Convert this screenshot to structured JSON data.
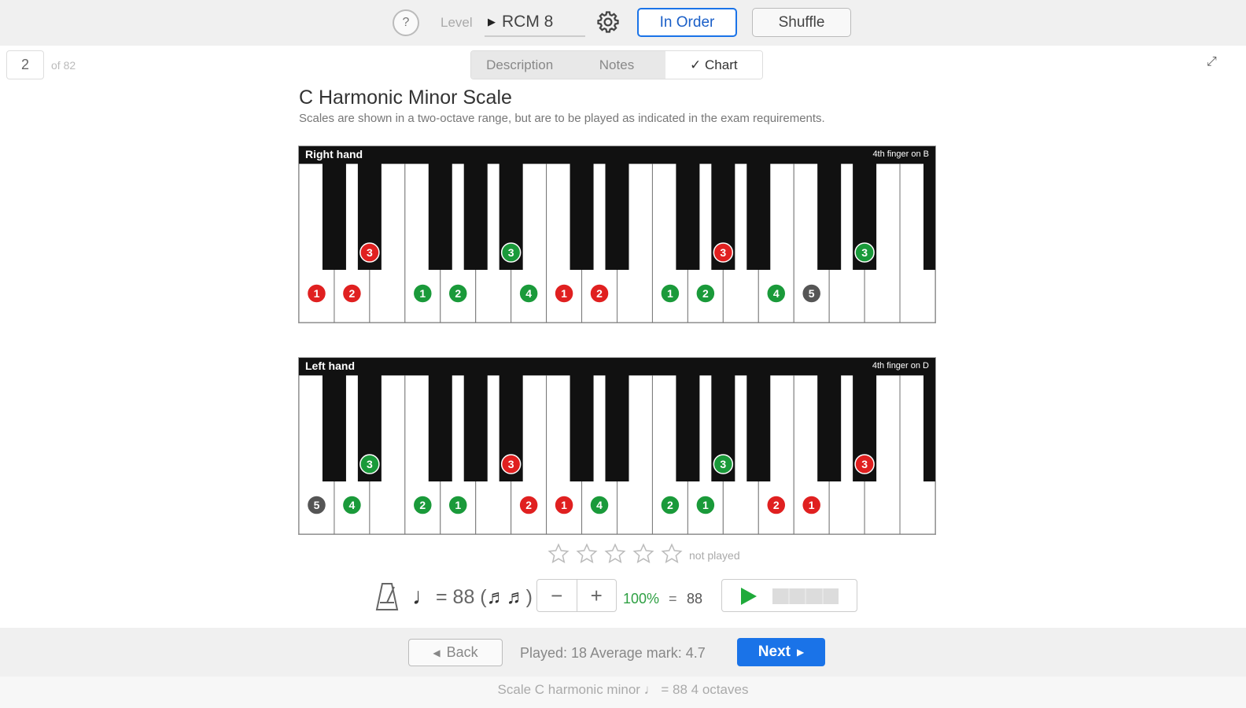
{
  "topbar": {
    "help_label": "?",
    "level_label": "Level",
    "level_value": "RCM 8",
    "in_order_label": "In Order",
    "shuffle_label": "Shuffle"
  },
  "nav": {
    "current_index": "2",
    "total_label": "of 82",
    "tabs": [
      {
        "label": "Description",
        "active": false
      },
      {
        "label": "Notes",
        "active": false
      },
      {
        "label": "✓ Chart",
        "active": true
      }
    ]
  },
  "scale": {
    "title": "C Harmonic Minor Scale",
    "subtitle": "Scales are shown in a two-octave range, but are to be played as indicated in the exam requirements."
  },
  "keyboards": [
    {
      "label": "Right hand",
      "note": "4th finger on B",
      "white_fingers": [
        {
          "key": 0,
          "finger": "1",
          "color": "#e02020"
        },
        {
          "key": 1,
          "finger": "2",
          "color": "#e02020"
        },
        {
          "key": 3,
          "finger": "1",
          "color": "#1a9a3a"
        },
        {
          "key": 4,
          "finger": "2",
          "color": "#1a9a3a"
        },
        {
          "key": 6,
          "finger": "4",
          "color": "#1a9a3a"
        },
        {
          "key": 7,
          "finger": "1",
          "color": "#e02020"
        },
        {
          "key": 8,
          "finger": "2",
          "color": "#e02020"
        },
        {
          "key": 10,
          "finger": "1",
          "color": "#1a9a3a"
        },
        {
          "key": 11,
          "finger": "2",
          "color": "#1a9a3a"
        },
        {
          "key": 13,
          "finger": "4",
          "color": "#1a9a3a"
        },
        {
          "key": 14,
          "finger": "5",
          "color": "#555555"
        }
      ],
      "black_fingers": [
        {
          "key": 1,
          "finger": "3",
          "color": "#e02020"
        },
        {
          "key": 4,
          "finger": "3",
          "color": "#1a9a3a"
        },
        {
          "key": 8,
          "finger": "3",
          "color": "#e02020"
        },
        {
          "key": 11,
          "finger": "3",
          "color": "#1a9a3a"
        }
      ]
    },
    {
      "label": "Left hand",
      "note": "4th finger on D",
      "white_fingers": [
        {
          "key": 0,
          "finger": "5",
          "color": "#555555"
        },
        {
          "key": 1,
          "finger": "4",
          "color": "#1a9a3a"
        },
        {
          "key": 3,
          "finger": "2",
          "color": "#1a9a3a"
        },
        {
          "key": 4,
          "finger": "1",
          "color": "#1a9a3a"
        },
        {
          "key": 6,
          "finger": "2",
          "color": "#e02020"
        },
        {
          "key": 7,
          "finger": "1",
          "color": "#e02020"
        },
        {
          "key": 8,
          "finger": "4",
          "color": "#1a9a3a"
        },
        {
          "key": 10,
          "finger": "2",
          "color": "#1a9a3a"
        },
        {
          "key": 11,
          "finger": "1",
          "color": "#1a9a3a"
        },
        {
          "key": 13,
          "finger": "2",
          "color": "#e02020"
        },
        {
          "key": 14,
          "finger": "1",
          "color": "#e02020"
        }
      ],
      "black_fingers": [
        {
          "key": 1,
          "finger": "3",
          "color": "#1a9a3a"
        },
        {
          "key": 4,
          "finger": "3",
          "color": "#e02020"
        },
        {
          "key": 8,
          "finger": "3",
          "color": "#1a9a3a"
        },
        {
          "key": 11,
          "finger": "3",
          "color": "#e02020"
        }
      ]
    }
  ],
  "rating": {
    "stars": 0,
    "max_stars": 5,
    "status": "not played"
  },
  "tempo": {
    "note_symbol": "♩",
    "text_prefix": "= 88 (",
    "text_suffix": ")",
    "rhythm_symbol": "♬♬",
    "minus_label": "−",
    "plus_label": "+",
    "percent": "100%",
    "equals": "=",
    "bpm": "88",
    "progress": 0
  },
  "bottom": {
    "back_label": "Back",
    "stats": "Played: 18  Average mark: 4.7",
    "next_label": "Next"
  },
  "footer": {
    "text": "Scale  C harmonic minor ♩ = 88  4 octaves"
  },
  "colors": {
    "accent": "#1a73e8",
    "red_finger": "#e02020",
    "green_finger": "#1a9a3a",
    "gray_finger": "#555555"
  }
}
